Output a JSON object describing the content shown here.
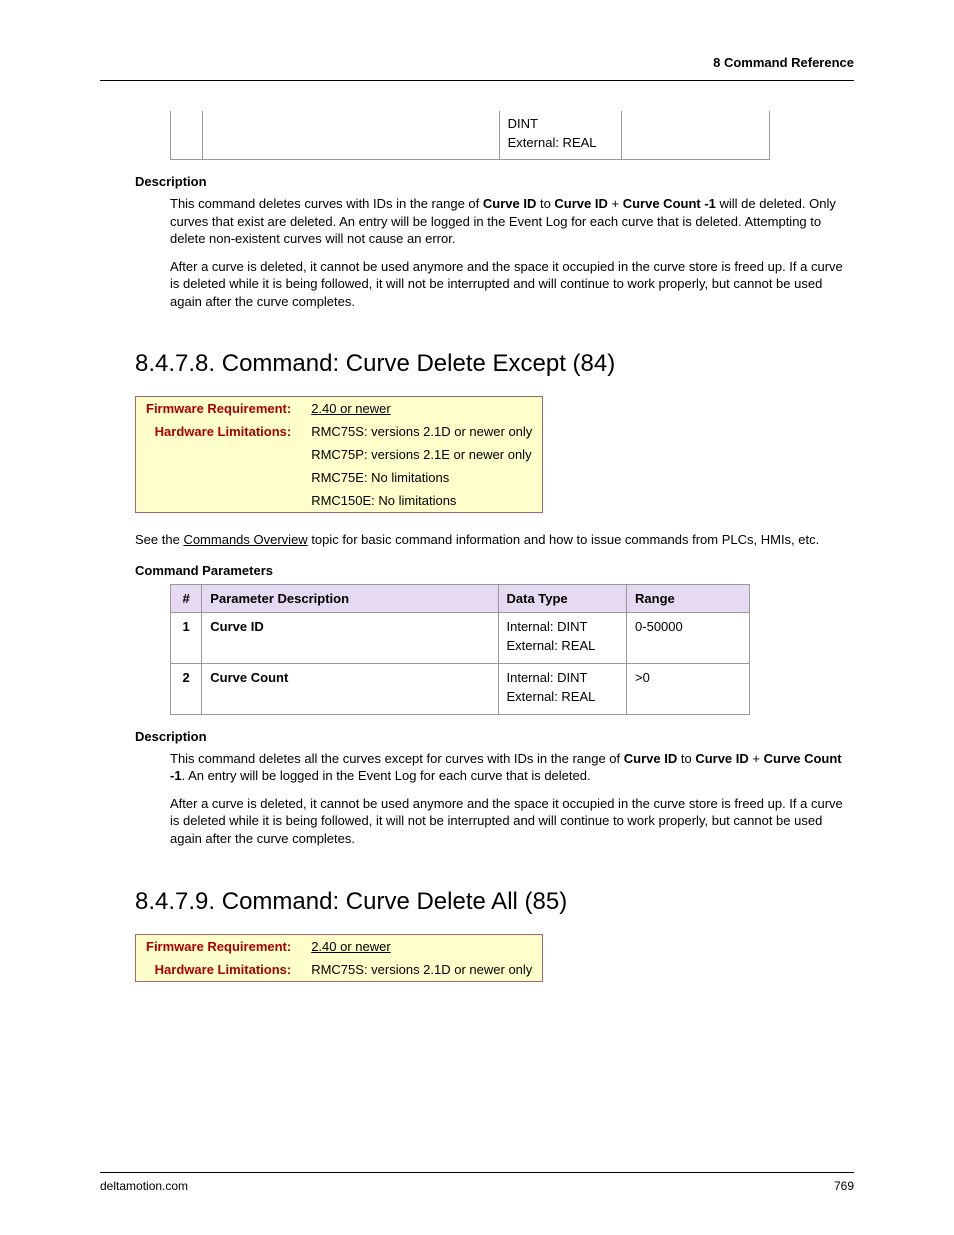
{
  "header": {
    "section": "8  Command Reference"
  },
  "frag": {
    "cell3a": "DINT",
    "cell3b": "External: REAL"
  },
  "sec1": {
    "descHead": "Description",
    "p1a": "This command deletes curves with IDs in the range of ",
    "p1b": "Curve ID",
    "p1c": " to ",
    "p1d": "Curve ID",
    "p1e": " + ",
    "p1f": "Curve Count -1",
    "p1g": " will de deleted. Only curves that exist are deleted. An entry will be logged in the Event Log for each curve that is deleted. Attempting to delete non-existent curves will not cause an error.",
    "p2": "After a curve is deleted, it cannot be used anymore and the space it occupied in the curve store is freed up. If a curve is deleted while it is being followed, it will not be interrupted and will continue to work properly, but cannot be used again after the curve completes."
  },
  "cmd84": {
    "heading": "8.4.7.8. Command: Curve Delete Except (84)",
    "info": {
      "fwLabel": "Firmware Requirement:",
      "fwValue": "2.40 or newer",
      "hwLabel": "Hardware Limitations:",
      "hw1": "RMC75S: versions 2.1D or newer only",
      "hw2": "RMC75P: versions 2.1E or newer only",
      "hw3": "RMC75E: No limitations",
      "hw4": "RMC150E: No limitations"
    },
    "seeA": "See the ",
    "seeLink": "Commands Overview",
    "seeB": " topic for basic command information and how to issue commands from PLCs, HMIs, etc.",
    "paramHead": "Command Parameters",
    "cols": {
      "num": "#",
      "desc": "Parameter Description",
      "dtype": "Data Type",
      "range": "Range"
    },
    "rows": [
      {
        "n": "1",
        "desc": "Curve ID",
        "dt1": "Internal: DINT",
        "dt2": "External: REAL",
        "range": "0-50000"
      },
      {
        "n": "2",
        "desc": "Curve Count",
        "dt1": "Internal: DINT",
        "dt2": "External: REAL",
        "range": ">0"
      }
    ],
    "descHead": "Description",
    "d1a": "This command deletes all the curves except for curves with IDs in the range of ",
    "d1b": "Curve ID",
    "d1c": " to ",
    "d1d": "Curve ID",
    "d1e": " + ",
    "d1f": "Curve Count -1",
    "d1g": ". An entry will be logged in the Event Log for each curve that is deleted.",
    "d2": "After a curve is deleted, it cannot be used anymore and the space it occupied in the curve store is freed up.  If a curve is deleted while it is being followed, it will not be interrupted and will continue to work properly, but cannot be used again after the curve completes."
  },
  "cmd85": {
    "heading": "8.4.7.9. Command: Curve Delete All (85)",
    "info": {
      "fwLabel": "Firmware Requirement:",
      "fwValue": "2.40 or newer",
      "hwLabel": "Hardware Limitations:",
      "hw1": "RMC75S: versions 2.1D or newer only"
    }
  },
  "footer": {
    "site": "deltamotion.com",
    "page": "769"
  }
}
